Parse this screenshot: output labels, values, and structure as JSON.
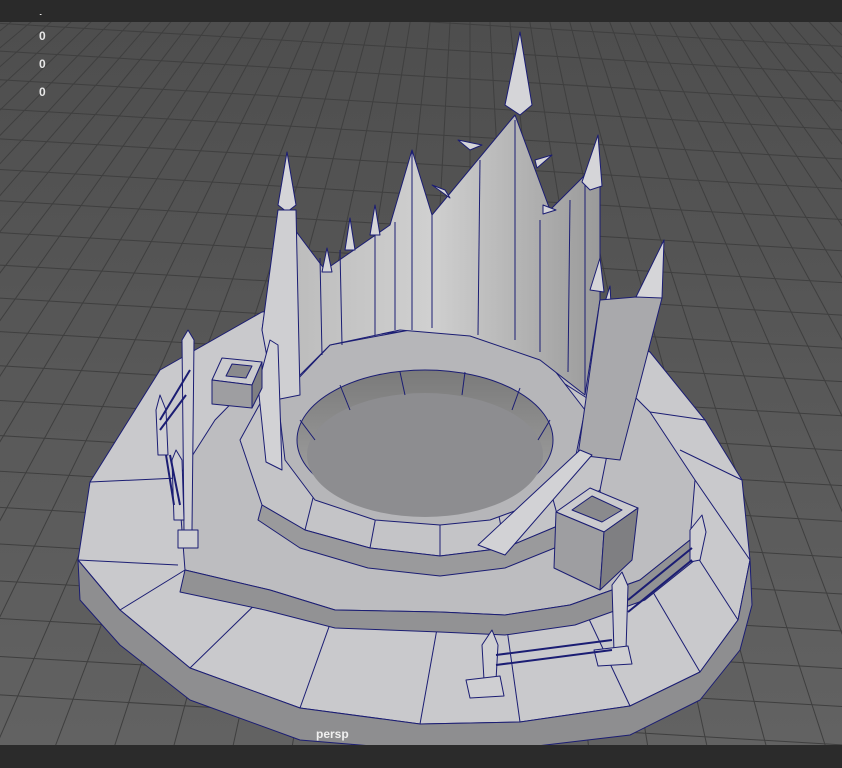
{
  "viewport": {
    "camera_name": "persp",
    "hud_values": [
      "0",
      "0",
      "0"
    ],
    "colors": {
      "background": "#5a5a5a",
      "grid_line": "#3e3e3e",
      "mesh_face": "#c8c8c8",
      "mesh_shadow": "#8a8a8a",
      "wireframe": "#1b1d73",
      "ui_bar": "#2b2b2b"
    }
  },
  "scene": {
    "object": "castle-ring-model",
    "components": [
      "grid-floor",
      "stepped-base",
      "inner-well",
      "crown-wall",
      "spires",
      "planter-boxes",
      "chain-fences"
    ]
  }
}
